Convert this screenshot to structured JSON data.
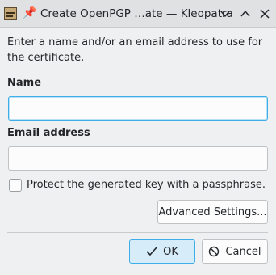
{
  "window": {
    "title": "Create OpenPGP …ate — Kleopatra",
    "pin_icon": "pin-icon",
    "controls": [
      "minimize-icon",
      "maximize-icon",
      "close-icon"
    ]
  },
  "form": {
    "description": "Enter a name and/or an email address to use for the certificate.",
    "name_label": "Name",
    "name_value": "",
    "email_label": "Email address",
    "email_value": "",
    "passphrase_label": "Protect the generated key with a passphrase.",
    "passphrase_checked": false,
    "advanced_label": "Advanced Settings..."
  },
  "buttons": {
    "ok_label": "OK",
    "cancel_label": "Cancel"
  },
  "colors": {
    "accent": "#3daee9",
    "background": "#eff0f1"
  }
}
